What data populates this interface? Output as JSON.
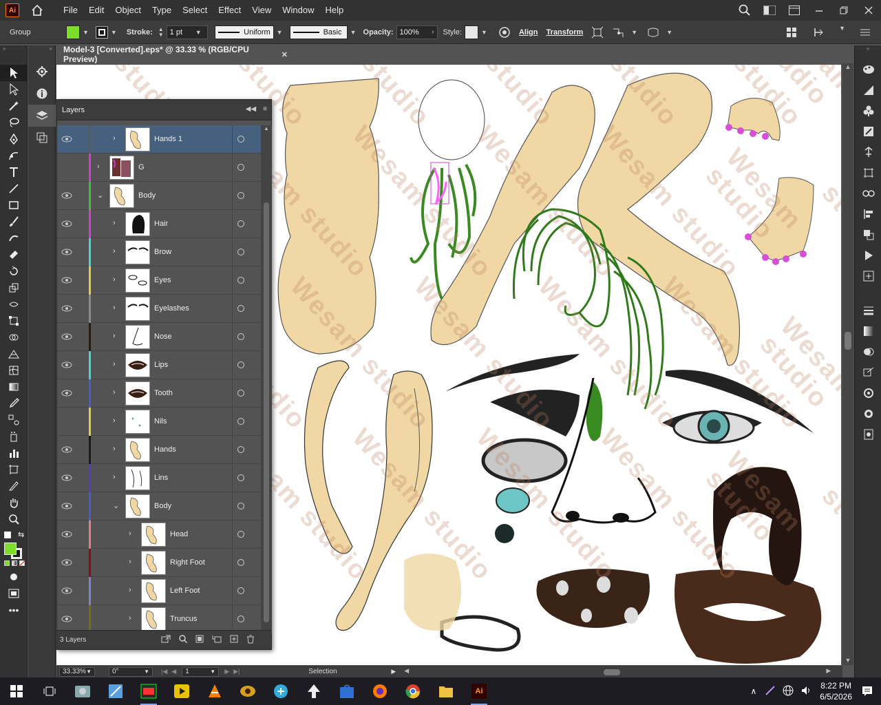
{
  "app": {
    "logo": "Ai",
    "menu": [
      "File",
      "Edit",
      "Object",
      "Type",
      "Select",
      "Effect",
      "View",
      "Window",
      "Help"
    ]
  },
  "control": {
    "selection_type": "Group",
    "fill_color": "#7ddc2c",
    "stroke_label": "Stroke:",
    "stroke_weight": "1 pt",
    "profile_uniform": "Uniform",
    "brush_basic": "Basic",
    "opacity_label": "Opacity:",
    "opacity_value": "100%",
    "style_label": "Style:",
    "align": "Align",
    "transform": "Transform"
  },
  "document": {
    "tab_title": "Model-3 [Converted].eps* @ 33.33 % (RGB/CPU Preview)",
    "watermark": "Wesam studio"
  },
  "layers_panel": {
    "title": "Layers",
    "layer_count": "3 Layers",
    "rows": [
      {
        "name": "Hands 1",
        "depth": 1,
        "expanded": false,
        "visible": true,
        "color": "#5a5a5a",
        "selected": true
      },
      {
        "name": "G",
        "depth": 0,
        "expanded": false,
        "visible": false,
        "color": "#d040d0",
        "selected": false
      },
      {
        "name": "Body",
        "depth": 0,
        "expanded": true,
        "visible": true,
        "color": "#3cbf3c",
        "selected": false
      },
      {
        "name": "Hair",
        "depth": 1,
        "expanded": false,
        "visible": true,
        "color": "#d040d0",
        "selected": false
      },
      {
        "name": "Brow",
        "depth": 1,
        "expanded": false,
        "visible": true,
        "color": "#40d8d8",
        "selected": false
      },
      {
        "name": "Eyes",
        "depth": 1,
        "expanded": false,
        "visible": true,
        "color": "#e0d040",
        "selected": false
      },
      {
        "name": "Eyelashes",
        "depth": 1,
        "expanded": false,
        "visible": true,
        "color": "#8a8a8a",
        "selected": false
      },
      {
        "name": "Nose",
        "depth": 1,
        "expanded": false,
        "visible": true,
        "color": "#2a1a10",
        "selected": false
      },
      {
        "name": "Lips",
        "depth": 1,
        "expanded": false,
        "visible": true,
        "color": "#40d8d8",
        "selected": false
      },
      {
        "name": "Tooth",
        "depth": 1,
        "expanded": false,
        "visible": true,
        "color": "#4060d0",
        "selected": false
      },
      {
        "name": "Nils",
        "depth": 1,
        "expanded": false,
        "visible": false,
        "color": "#e0d040",
        "selected": false
      },
      {
        "name": "Hands",
        "depth": 1,
        "expanded": false,
        "visible": true,
        "color": "#1a1a1a",
        "selected": false
      },
      {
        "name": "Lins",
        "depth": 1,
        "expanded": false,
        "visible": true,
        "color": "#5040c0",
        "selected": false
      },
      {
        "name": "Body",
        "depth": 1,
        "expanded": true,
        "visible": true,
        "color": "#4060d0",
        "selected": false
      },
      {
        "name": "Head",
        "depth": 2,
        "expanded": false,
        "visible": true,
        "color": "#e08080",
        "selected": false
      },
      {
        "name": "Right Foot",
        "depth": 2,
        "expanded": false,
        "visible": true,
        "color": "#8a1010",
        "selected": false
      },
      {
        "name": "Left Foot",
        "depth": 2,
        "expanded": false,
        "visible": true,
        "color": "#8080d0",
        "selected": false
      },
      {
        "name": "Truncus",
        "depth": 2,
        "expanded": false,
        "visible": true,
        "color": "#7a6a10",
        "selected": false
      }
    ]
  },
  "status": {
    "zoom": "33.33%",
    "rotation": "0°",
    "artboard": "1",
    "tool": "Selection"
  },
  "taskbar": {
    "time": "8:22 PM",
    "date": "6/5/2026"
  }
}
